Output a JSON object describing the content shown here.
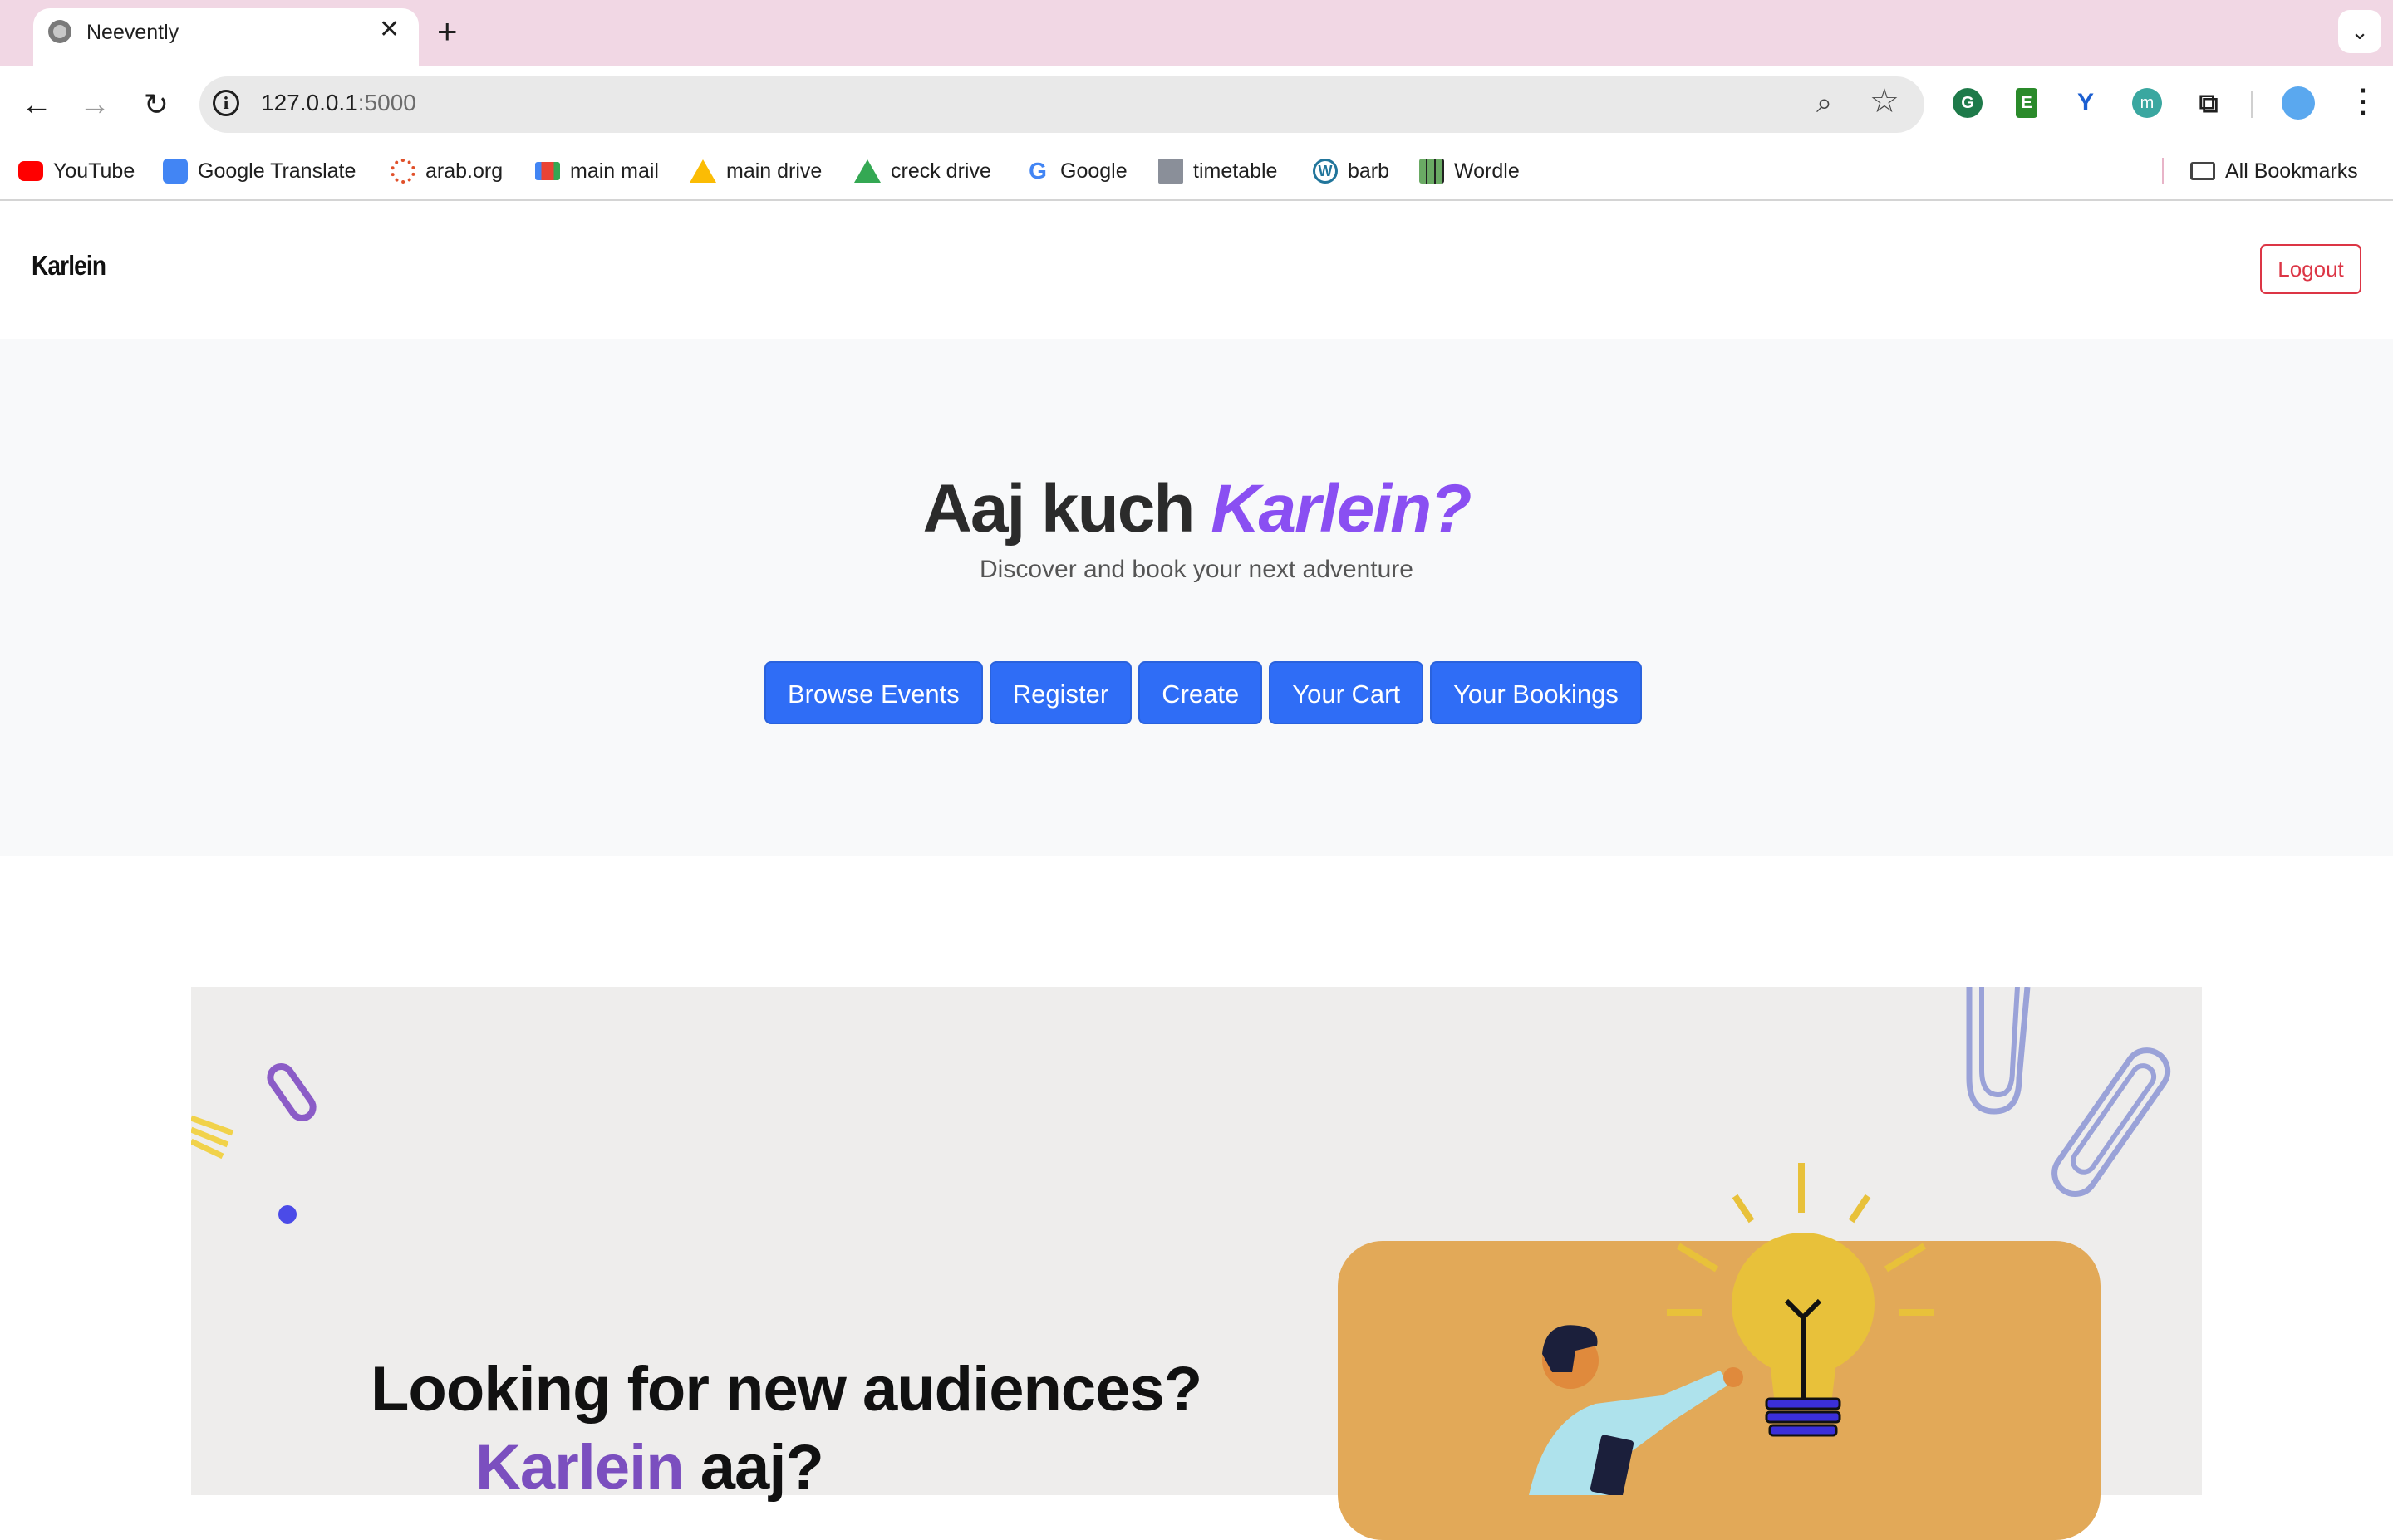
{
  "browser": {
    "tab_title": "Neevently",
    "url_host": "127.0.0.1",
    "url_port": ":5000",
    "bookmarks": [
      {
        "label": "YouTube",
        "icon": "youtube-icon"
      },
      {
        "label": "Google Translate",
        "icon": "google-translate-icon"
      },
      {
        "label": "arab.org",
        "icon": "arab-org-icon"
      },
      {
        "label": "main mail",
        "icon": "gmail-icon"
      },
      {
        "label": "main drive",
        "icon": "google-drive-icon"
      },
      {
        "label": "creck drive",
        "icon": "google-drive-icon"
      },
      {
        "label": "Google",
        "icon": "google-icon"
      },
      {
        "label": "timetable",
        "icon": "building-icon"
      },
      {
        "label": "barb",
        "icon": "wordpress-icon"
      },
      {
        "label": "Wordle",
        "icon": "grid-icon"
      }
    ],
    "all_bookmarks_label": "All Bookmarks"
  },
  "navbar": {
    "brand": "Karlein",
    "logout_label": "Logout"
  },
  "hero": {
    "title_prefix": "Aaj kuch",
    "title_brand": "Karlein?",
    "subtitle": "Discover and book your next adventure",
    "buttons": [
      "Browse Events",
      "Register",
      "Create",
      "Your Cart",
      "Your Bookings"
    ]
  },
  "banner": {
    "line1": "Looking for new audiences?",
    "line2_brand": "Karlein",
    "line2_suffix": "aaj?"
  },
  "colors": {
    "tabstrip": "#f1d7e4",
    "accent_purple": "#8a4ff2",
    "primary_button": "#2f6df6",
    "danger": "#dc3545",
    "illustration_card": "#e2a958"
  }
}
